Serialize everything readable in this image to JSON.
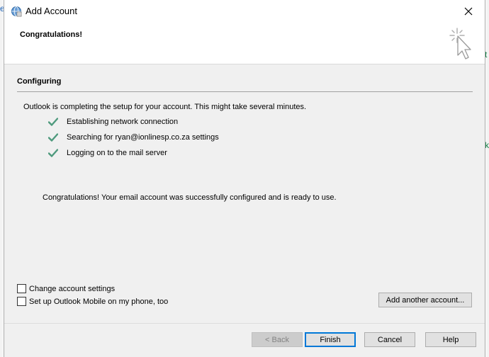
{
  "window": {
    "title": "Add Account"
  },
  "header": {
    "title": "Congratulations!"
  },
  "section": {
    "title": "Configuring",
    "intro": "Outlook is completing the setup for your account. This might take several minutes."
  },
  "steps": [
    {
      "label": "Establishing network connection",
      "icon": "check-icon",
      "status": "done"
    },
    {
      "label": "Searching for ryan@ionlinesp.co.za settings",
      "icon": "check-icon",
      "status": "done"
    },
    {
      "label": "Logging on to the mail server",
      "icon": "check-icon",
      "status": "done"
    }
  ],
  "message": "Congratulations! Your email account was successfully configured and is ready to use.",
  "options": {
    "change_settings": {
      "label": "Change account settings",
      "checked": false
    },
    "mobile_setup": {
      "label": "Set up Outlook Mobile on my phone, too",
      "checked": false
    }
  },
  "buttons": {
    "add_another": "Add another account...",
    "back": "< Back",
    "finish": "Finish",
    "cancel": "Cancel",
    "help": "Help"
  },
  "background": {
    "left_glyph": "e",
    "right_glyph_1": "t",
    "right_glyph_2": "k"
  },
  "colors": {
    "accent": "#0078d7",
    "check": "#4e9a7d",
    "dialog_bg": "#f0f0f0"
  }
}
